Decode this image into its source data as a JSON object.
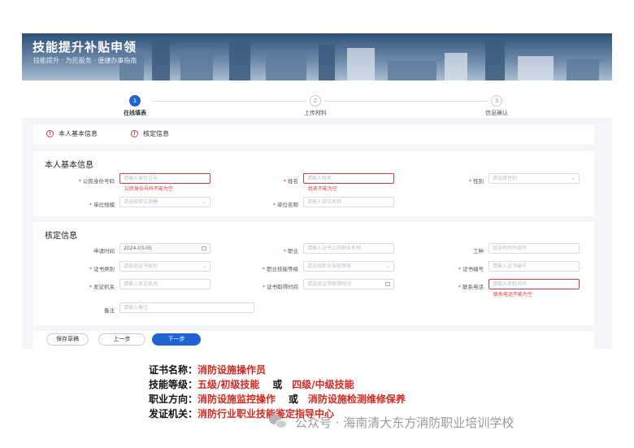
{
  "banner": {
    "title": "技能提升补贴申领",
    "subtitle": "技能提升 · 为民服务 · 便捷办事指南"
  },
  "steps": [
    {
      "num": "1",
      "label": "在线填表",
      "active": true
    },
    {
      "num": "2",
      "label": "上传材料",
      "active": false
    },
    {
      "num": "3",
      "label": "信息确认",
      "active": false
    }
  ],
  "tabs": [
    {
      "label": "本人基本信息"
    },
    {
      "label": "核定信息"
    }
  ],
  "basic": {
    "title": "本人基本信息",
    "id_label": "公民身份号码",
    "id_placeholder": "请输入身份证号",
    "id_error": "公民身份号码不能为空",
    "name_label": "姓名",
    "name_placeholder": "请输入姓名",
    "name_error": "姓名不能为空",
    "gender_label": "性别",
    "gender_placeholder": "请选择性别",
    "unit_scale_label": "单位规模",
    "unit_scale_placeholder": "请选择单位规模",
    "unit_name_label": "单位名称",
    "unit_name_placeholder": "请输入单位名称"
  },
  "verify": {
    "title": "核定信息",
    "apply_time_label": "申请时间",
    "apply_time_value": "2024-03-05",
    "job_label": "职业",
    "job_placeholder": "请输入证书上的职业名称",
    "trade_label": "工种",
    "trade_placeholder": "如没有则不填写",
    "cert_type_label": "证书类别",
    "cert_type_placeholder": "请选择证书类别",
    "skill_level_label": "职业技能等级",
    "skill_level_placeholder": "请选择职业技能等级",
    "cert_no_label": "证书编号",
    "cert_no_placeholder": "请输入证书编号",
    "issuer_label": "发证机关",
    "issuer_placeholder": "请输入发证机关",
    "cert_date_label": "证书取得时间",
    "cert_date_placeholder": "请选择证书取得时间",
    "phone_label": "联系电话",
    "phone_placeholder": "请输入手机号码",
    "phone_error": "联系电话不能为空",
    "remark_label": "备注",
    "remark_placeholder": "请输入备注"
  },
  "buttons": {
    "save_draft": "保存草稿",
    "prev": "上一步",
    "next": "下一步"
  },
  "caption": {
    "row1_key": "证书名称：",
    "row1_val": "消防设施操作员",
    "row2_key": "技能等级：",
    "row2_val_a": "五级/初级技能",
    "row2_or": "或",
    "row2_val_b": "四级/中级技能",
    "row3_key": "职业方向：",
    "row3_val_a": "消防设施监控操作",
    "row3_or": "或",
    "row3_val_b": "消防设施检测维修保养",
    "row4_key": "发证机关：",
    "row4_val": "消防行业职业技能鉴定指导中心"
  },
  "watermark": {
    "text": "公众号 · 海南清大东方消防职业培训学校"
  },
  "colors": {
    "primary": "#1f63d6",
    "error": "#d9363e",
    "caption_red": "#d7261e"
  }
}
